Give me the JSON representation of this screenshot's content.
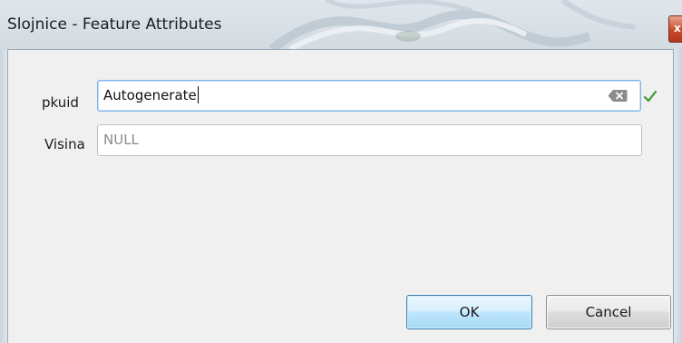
{
  "window": {
    "title": "Slojnice - Feature Attributes",
    "close_glyph": "x"
  },
  "form": {
    "fields": [
      {
        "label": "pkuid",
        "value": "Autogenerate",
        "clear_icon": "clear-text-icon",
        "status_icon": "checkmark-icon",
        "status_color": "#3a9a2a"
      },
      {
        "label": "Visina",
        "value": "NULL"
      }
    ]
  },
  "buttons": {
    "ok_label": "OK",
    "cancel_label": "Cancel"
  }
}
